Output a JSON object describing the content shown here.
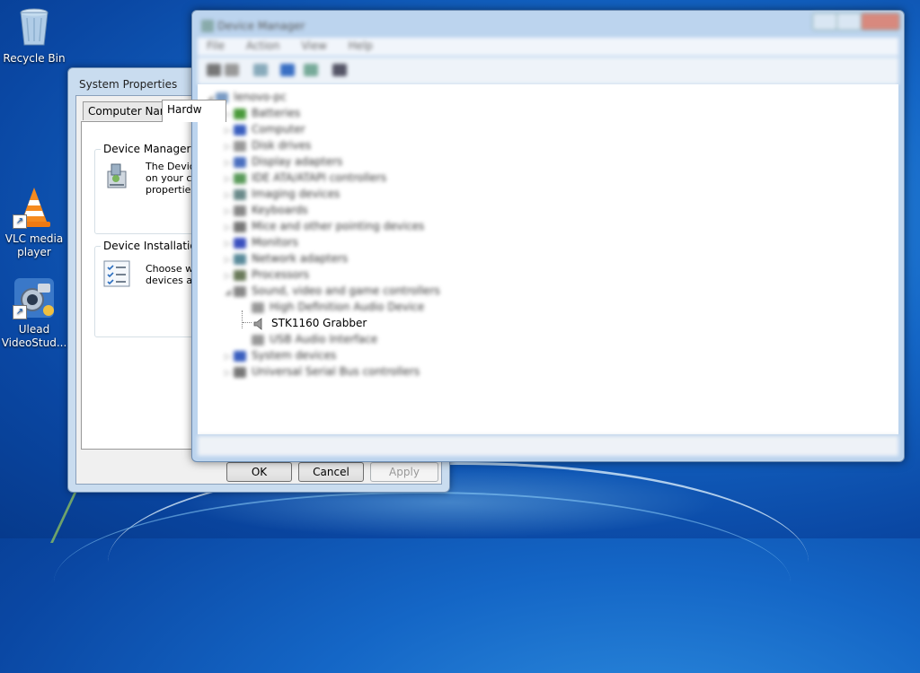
{
  "desktop": {
    "icons": [
      {
        "label": "Recycle Bin",
        "icon": "recycle-bin-icon"
      },
      {
        "label": "VLC media player",
        "icon": "vlc-cone-icon"
      },
      {
        "label": "Ulead VideoStud...",
        "icon": "ulead-videostudio-icon"
      }
    ]
  },
  "system_properties": {
    "title": "System Properties",
    "tabs": [
      {
        "label": "Computer Name",
        "active": false
      },
      {
        "label": "Hardw",
        "active": true
      }
    ],
    "device_manager_group": {
      "title": "Device Manager",
      "text_lines": [
        "The Device",
        "on your co",
        "properties c"
      ]
    },
    "device_installation_group": {
      "title": "Device Installation Se",
      "text_lines": [
        "Choose wh",
        "devices an"
      ]
    },
    "buttons": {
      "ok": "OK",
      "cancel": "Cancel",
      "apply": "Apply"
    }
  },
  "device_manager": {
    "title": "Device Manager",
    "menu": [
      "File",
      "Action",
      "View",
      "Help"
    ],
    "tree": {
      "root": "lenovo-pc",
      "categories": [
        "Batteries",
        "Computer",
        "Disk drives",
        "Display adapters",
        "IDE ATA/ATAPI controllers",
        "Imaging devices",
        "Keyboards",
        "Mice and other pointing devices",
        "Monitors",
        "Network adapters",
        "Processors",
        "Sound, video and game controllers"
      ],
      "sound_children": [
        "High Definition Audio Device",
        "STK1160 Grabber",
        "USB Audio Interface"
      ],
      "after_categories": [
        "System devices",
        "Universal Serial Bus controllers"
      ],
      "selected_item": "STK1160 Grabber"
    }
  }
}
